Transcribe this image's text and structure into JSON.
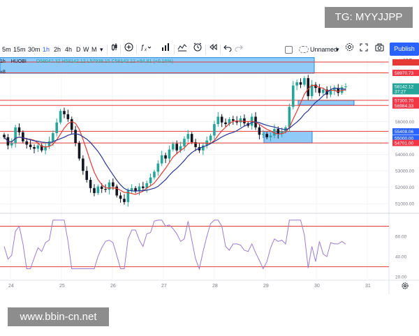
{
  "overlay": {
    "telegram_tag": "TG: MYYJJPP",
    "site_watermark": "www.bbin-cn.net"
  },
  "toolbar": {
    "intervals": [
      "5m",
      "15m",
      "30m",
      "1h",
      "2h",
      "4h",
      "D",
      "W",
      "M"
    ],
    "active_interval": "1h",
    "interval_dropdown_glyph": "▾",
    "icons": [
      "candles-icon",
      "add-indicator-icon",
      "fx-icon",
      "templates-icon",
      "compare-icon",
      "alert-icon",
      "replay-icon",
      "undo-icon",
      "redo-icon"
    ],
    "layout_name": "Unnamed",
    "layout_dropdown_glyph": "▾",
    "publish_label": "Publish"
  },
  "legend": {
    "interval_label": "1h",
    "exchange": "HUOBI",
    "ohlc_text": "O58047.32 H58142.12 L57938.15 C58142.12 +94.81 (+0.16%)",
    "collapse_glyph": "»8"
  },
  "price_axis": {
    "currency": "USDT",
    "ticks": [
      "56000.00",
      "55000.00",
      "54000.00",
      "53000.00",
      "52000.00",
      "51000.00"
    ],
    "labels": [
      {
        "text": "58970.73",
        "color": "#f23645"
      },
      {
        "text": "58142.12",
        "color": "#26a69a"
      },
      {
        "text": "37:27",
        "color": "#26a69a"
      },
      {
        "text": "57300.70",
        "color": "#f23645"
      },
      {
        "text": "56984.33",
        "color": "#f23645"
      },
      {
        "text": "55408.06",
        "color": "#2962ff"
      },
      {
        "text": "55000.00",
        "color": "#2962ff"
      },
      {
        "text": "54701.00",
        "color": "#f23645"
      }
    ]
  },
  "rsi_axis": {
    "ticks": [
      "60.00",
      "40.00",
      "20.00"
    ]
  },
  "time_axis": {
    "ticks": [
      "24",
      "25",
      "26",
      "27",
      "28",
      "29",
      "30",
      "31"
    ],
    "settings_icon": "gear-icon"
  },
  "chart_data": {
    "type": "candlestick",
    "symbol_exchange": "HUOBI",
    "interval": "1h",
    "y_range": [
      50500,
      59800
    ],
    "x_range": [
      "24",
      "31"
    ],
    "resistance_zones": [
      {
        "from": 58950,
        "to": 59900,
        "color": "#2196f3"
      },
      {
        "from": 57000,
        "to": 57300.7,
        "color": "#2196f3"
      },
      {
        "from": 54701.0,
        "to": 55408.06,
        "color": "#2196f3"
      }
    ],
    "horizontal_levels": [
      58970.73,
      57300.7,
      56984.33,
      55408.06,
      54701.0
    ],
    "close_series": [
      55050,
      54550,
      54700,
      55650,
      55350,
      54800,
      54600,
      54450,
      54350,
      54550,
      54250,
      54500,
      54800,
      55300,
      55950,
      56650,
      56450,
      56150,
      55500,
      54700,
      53750,
      53000,
      52450,
      51950,
      51650,
      52050,
      51900,
      51850,
      52300,
      52050,
      51500,
      51300,
      51100,
      51800,
      51950,
      51750,
      52050,
      51950,
      52250,
      52600,
      52950,
      53450,
      53950,
      53750,
      54300,
      54650,
      54250,
      54500,
      54950,
      55250,
      54750,
      54450,
      54250,
      54550,
      54850,
      55150,
      55850,
      56300,
      55950,
      55850,
      56150,
      56050,
      55950,
      56200,
      55900,
      55750,
      56300,
      55650,
      55200,
      55250,
      55050,
      55150,
      55550,
      55250,
      55400,
      55650,
      56900,
      58200,
      58400,
      58250,
      58650,
      57550,
      58250,
      58050,
      57750,
      57950,
      57650,
      57900,
      58050,
      57750,
      58100,
      58142.12
    ],
    "rsi": {
      "levels": [
        70,
        30
      ],
      "y_range": [
        18,
        80
      ]
    }
  }
}
